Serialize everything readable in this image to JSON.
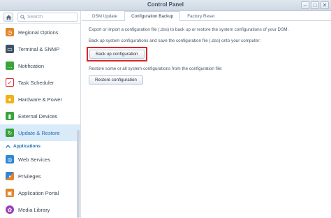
{
  "window": {
    "title": "Control Panel",
    "controls": [
      "–",
      "□",
      "✕"
    ]
  },
  "search": {
    "placeholder": "Search"
  },
  "sidebar": {
    "items": [
      {
        "label": "Regional Options",
        "icon": "globe-icon",
        "color": "#e0862a"
      },
      {
        "label": "Terminal & SNMP",
        "icon": "terminal-icon",
        "color": "#3e5266"
      },
      {
        "label": "Notification",
        "icon": "chat-icon",
        "color": "#3aa33c"
      },
      {
        "label": "Task Scheduler",
        "icon": "calendar-icon",
        "color": "#d9252a"
      },
      {
        "label": "Hardware & Power",
        "icon": "bulb-icon",
        "color": "#f0b21a"
      },
      {
        "label": "External Devices",
        "icon": "usb-icon",
        "color": "#3aa33c"
      },
      {
        "label": "Update & Restore",
        "icon": "refresh-icon",
        "color": "#36a13a"
      }
    ],
    "section": "Applications",
    "apps": [
      {
        "label": "Web Services",
        "icon": "web-icon",
        "color": "#2f86d3"
      },
      {
        "label": "Privileges",
        "icon": "privileges-icon",
        "color": "#2f86d3"
      },
      {
        "label": "Application Portal",
        "icon": "portal-icon",
        "color": "#e0862a"
      },
      {
        "label": "Media Library",
        "icon": "media-icon",
        "color": "#9b3fb5"
      }
    ]
  },
  "tabs": [
    "DSM Update",
    "Configuration Backup",
    "Factory Reset"
  ],
  "content": {
    "intro": "Export or import a configuration file (.dss) to back up or restore the system configurations of your DSM.",
    "backup_text": "Back up system configurations and save the configuration file (.dss) onto your computer:",
    "backup_button": "Back up configuration",
    "restore_text": "Restore some or all system configurations from the configuration file:",
    "restore_button": "Restore configuration"
  },
  "colors": {
    "accent": "#1f6fb5",
    "highlight": "#d9252a",
    "active_bg": "#d9eaf8"
  }
}
